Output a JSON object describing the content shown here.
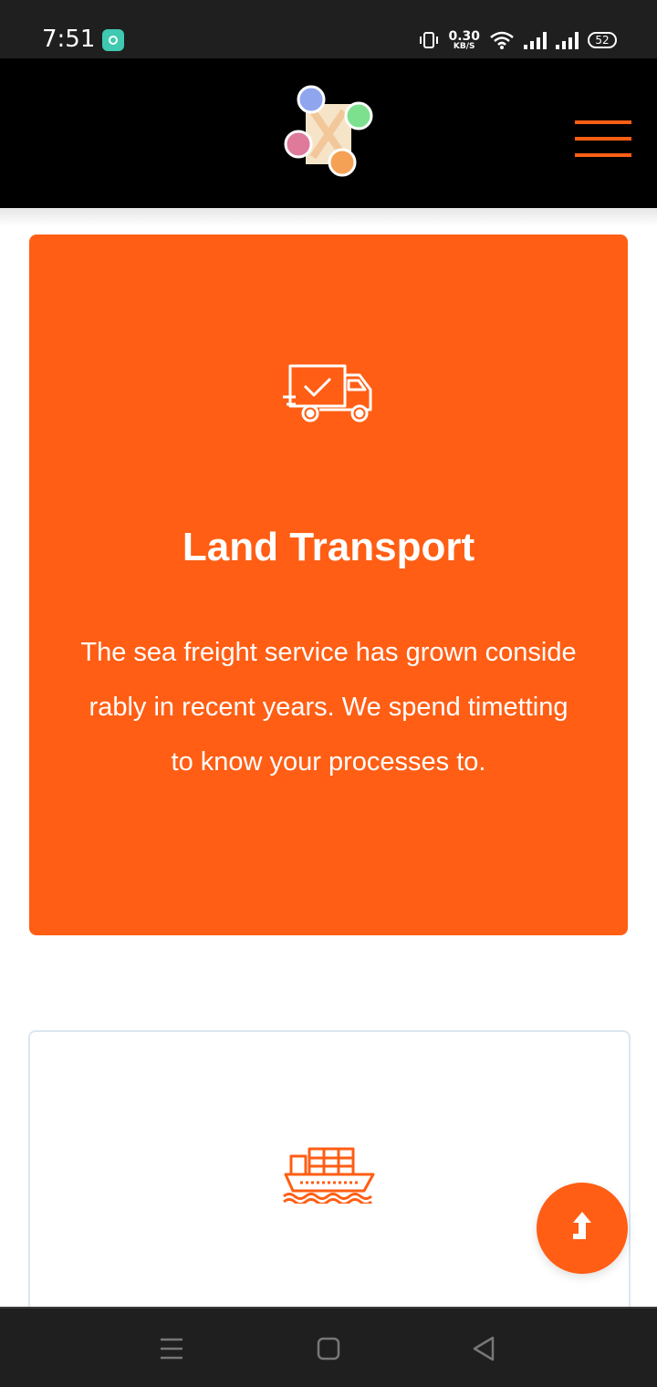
{
  "status_bar": {
    "time": "7:51",
    "network_speed": "0.30",
    "network_speed_unit": "KB/S",
    "battery": "52",
    "icons": [
      "app-notification-icon",
      "vibrate-icon",
      "wifi-icon",
      "signal-icon",
      "signal-icon",
      "battery-icon"
    ]
  },
  "header": {
    "logo_icon": "logo-icon",
    "menu_icon": "hamburger-menu-icon",
    "accent_color": "#ff5e14"
  },
  "services": [
    {
      "icon": "delivery-truck-icon",
      "title": "Land Transport",
      "description": "The sea freight service has grown conside rably in recent years. We spend timetting to know your processes to.",
      "background": "#ff5e14"
    },
    {
      "icon": "cargo-ship-icon",
      "background": "#ffffff"
    }
  ],
  "scroll_top_icon": "arrow-up-icon",
  "nav_bar": {
    "icons": [
      "recent-apps-icon",
      "home-icon",
      "back-icon"
    ]
  }
}
